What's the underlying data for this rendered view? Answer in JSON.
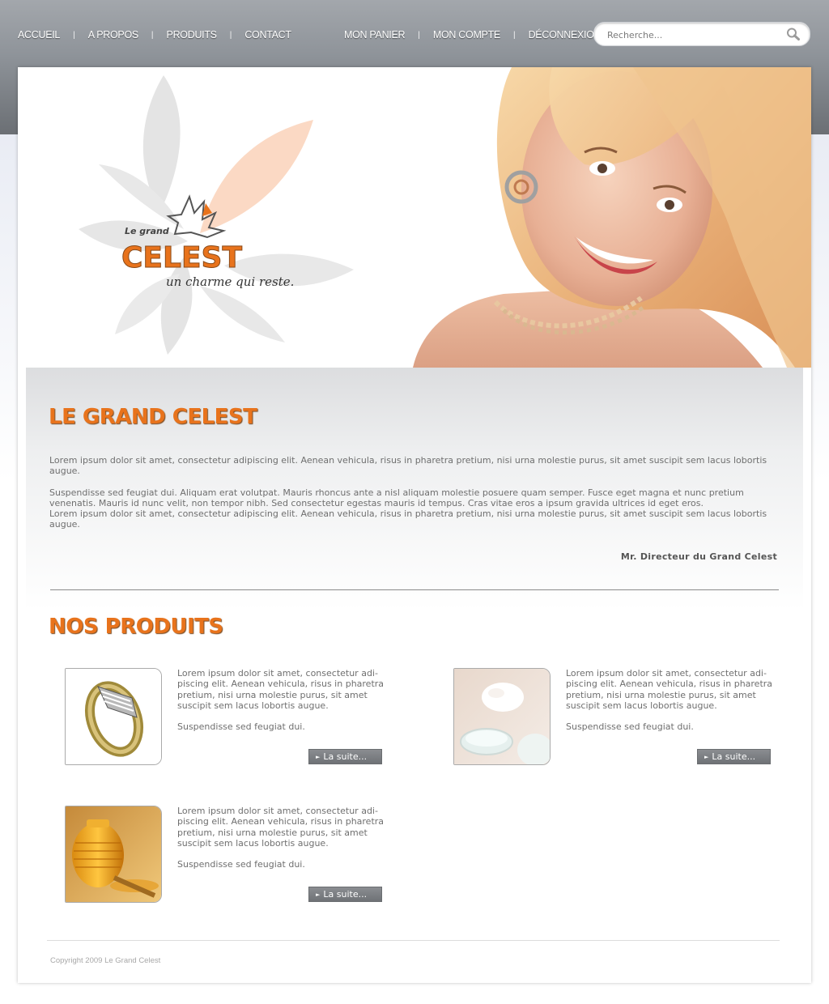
{
  "nav": {
    "left": [
      "ACCUEIL",
      "A PROPOS",
      "PRODUITS",
      "CONTACT"
    ],
    "right": [
      "MON PANIER",
      "MON COMPTE",
      "DÉCONNEXION"
    ],
    "separator": "|"
  },
  "search": {
    "placeholder": "Recherche..."
  },
  "hero": {
    "logo_small": "Le grand",
    "logo_big": "CELEST",
    "tagline": "un charme qui reste."
  },
  "intro": {
    "title": "LE GRAND CELEST",
    "p1": "Lorem ipsum dolor sit amet, consectetur adipiscing elit. Aenean vehicula, risus in pharetra pretium, nisi urna molestie purus, sit amet suscipit sem lacus lobortis augue.",
    "p2": "Suspendisse sed feugiat dui. Aliquam erat volutpat. Mauris rhoncus ante a nisl aliquam molestie posuere quam semper. Fusce eget magna et nunc pretium venenatis. Mauris id nunc velit, non tempor nibh. Sed consectetur egestas mauris id tempus. Cras vitae eros a ipsum gravida ultrices id eget eros.",
    "p3": "Lorem ipsum dolor sit amet, consectetur adipiscing elit. Aenean vehicula, risus in pharetra pretium, nisi urna molestie purus, sit amet suscipit sem lacus lobortis augue.",
    "signature": "Mr. Directeur du Grand Celest"
  },
  "products": {
    "title": "NOS PRODUITS",
    "items": [
      {
        "image": "ring",
        "text": "Lorem ipsum dolor sit amet, consectetur adi-piscing elit. Aenean vehicula, risus in pharetra pretium, nisi urna molestie purus, sit amet suscipit sem lacus lobortis augue.",
        "short": "Suspendisse sed feugiat dui.",
        "button": "La suite..."
      },
      {
        "image": "cream",
        "text": "Lorem ipsum dolor sit amet, consectetur adi-piscing elit. Aenean vehicula, risus in pharetra pretium, nisi urna molestie purus, sit amet suscipit sem lacus lobortis augue.",
        "short": "Suspendisse sed feugiat dui.",
        "button": "La suite..."
      },
      {
        "image": "honey",
        "text": "Lorem ipsum dolor sit amet, consectetur adi-piscing elit. Aenean vehicula, risus in pharetra pretium, nisi urna molestie purus, sit amet suscipit sem lacus lobortis augue.",
        "short": "Suspendisse sed feugiat dui.",
        "button": "La suite..."
      }
    ]
  },
  "footer": {
    "copyright": "Copyright 2009 Le Grand Celest"
  },
  "colors": {
    "accent": "#e8731c",
    "header": "#8f949a",
    "button": "#7b7e82"
  }
}
